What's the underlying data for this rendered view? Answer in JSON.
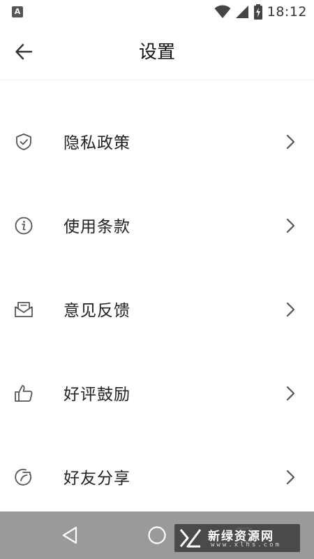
{
  "status_bar": {
    "left_icon_letter": "A",
    "time": "18:12",
    "icons": [
      "wifi-icon",
      "signal-icon",
      "battery-charging-icon"
    ]
  },
  "header": {
    "title": "设置",
    "back_icon": "arrow-left-icon"
  },
  "menu": {
    "items": [
      {
        "label": "隐私政策",
        "icon": "shield-check-icon"
      },
      {
        "label": "使用条款",
        "icon": "info-circle-icon"
      },
      {
        "label": "意见反馈",
        "icon": "mail-open-icon"
      },
      {
        "label": "好评鼓励",
        "icon": "thumbs-up-icon"
      },
      {
        "label": "好友分享",
        "icon": "share-circle-icon"
      }
    ]
  },
  "nav_bar": {
    "buttons": [
      "back-triangle-icon",
      "home-circle-icon",
      "recents-square-icon"
    ]
  },
  "watermark": {
    "title": "新绿资源网",
    "url": "www.xlhs.com"
  },
  "colors": {
    "text": "#222222",
    "icon": "#555555",
    "nav_bar": "#9a9a9a",
    "divider": "#f0f0f0"
  }
}
